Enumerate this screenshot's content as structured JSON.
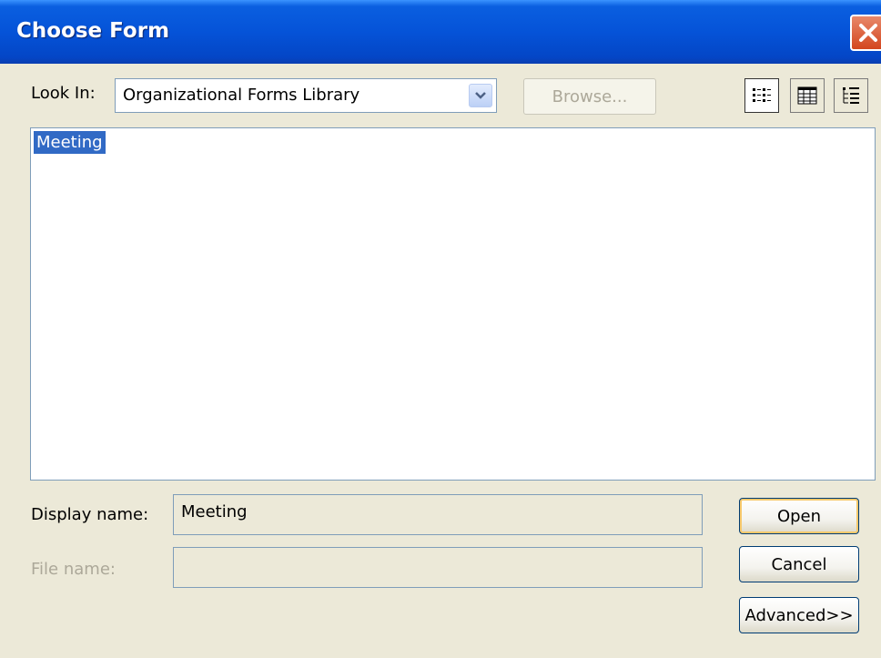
{
  "dialog": {
    "title": "Choose Form"
  },
  "look_in": {
    "label": "Look In:",
    "selected": "Organizational Forms Library"
  },
  "toolbar": {
    "browse_label": "Browse...",
    "view_icons": [
      "list-view-icon",
      "details-view-icon",
      "properties-view-icon"
    ]
  },
  "forms_list": {
    "items": [
      "Meeting"
    ],
    "selected_index": 0
  },
  "fields": {
    "display_name_label": "Display name:",
    "display_name_value": "Meeting",
    "file_name_label": "File name:",
    "file_name_value": ""
  },
  "buttons": {
    "open": "Open",
    "cancel": "Cancel",
    "advanced": "Advanced>>"
  },
  "colors": {
    "titlebar": "#0553d8",
    "selection": "#316ac5",
    "face": "#ece9d8"
  }
}
